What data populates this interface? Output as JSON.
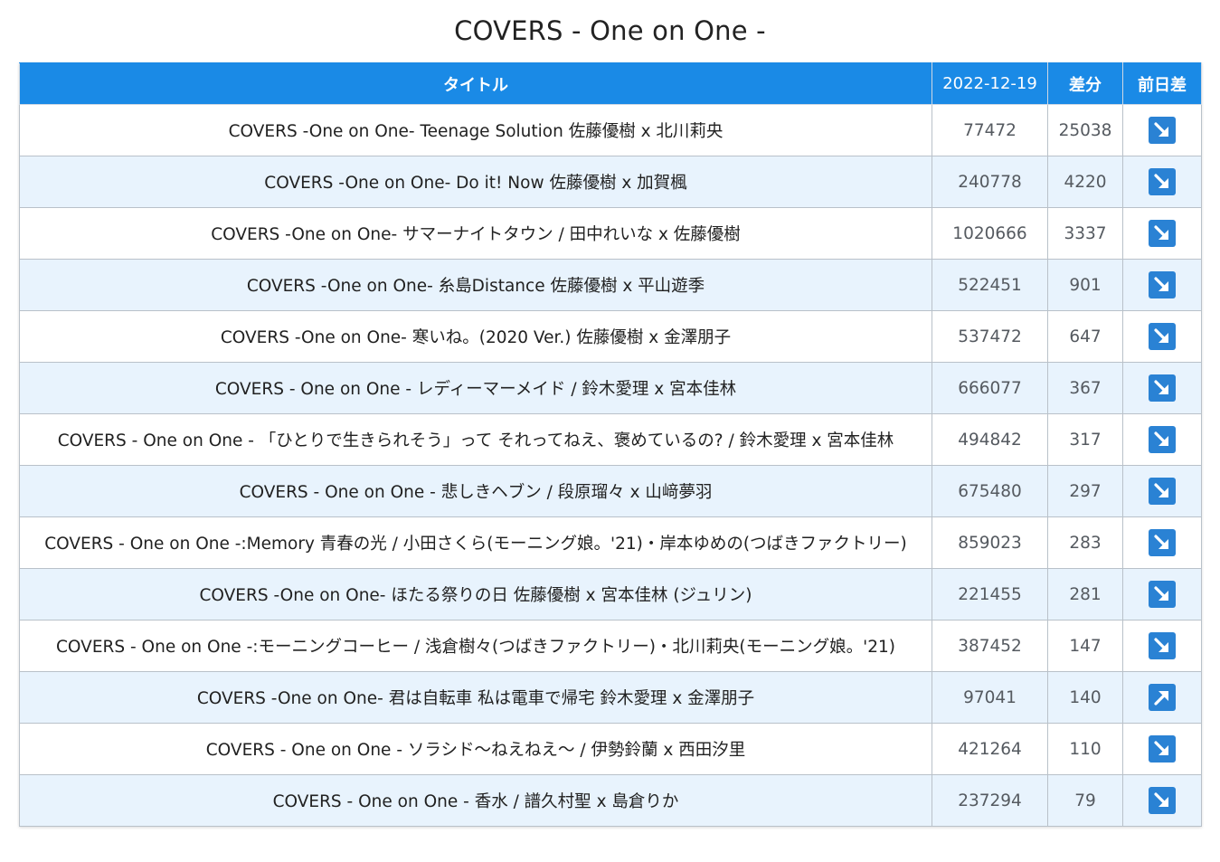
{
  "page": {
    "title": "COVERS - One on One -"
  },
  "table": {
    "headers": {
      "title": "タイトル",
      "count": "2022-12-19",
      "diff": "差分",
      "trend": "前日差"
    },
    "rows": [
      {
        "title": "COVERS -One on One- Teenage Solution 佐藤優樹 x 北川莉央",
        "count": "77472",
        "diff": "25038",
        "trend": "down"
      },
      {
        "title": "COVERS -One on One- Do it! Now 佐藤優樹 x 加賀楓",
        "count": "240778",
        "diff": "4220",
        "trend": "down"
      },
      {
        "title": "COVERS -One on One- サマーナイトタウン / 田中れいな x 佐藤優樹",
        "count": "1020666",
        "diff": "3337",
        "trend": "down"
      },
      {
        "title": "COVERS -One on One- 糸島Distance 佐藤優樹 x 平山遊季",
        "count": "522451",
        "diff": "901",
        "trend": "down"
      },
      {
        "title": "COVERS -One on One- 寒いね。(2020 Ver.) 佐藤優樹 x 金澤朋子",
        "count": "537472",
        "diff": "647",
        "trend": "down"
      },
      {
        "title": "COVERS - One on One - レディーマーメイド / 鈴木愛理 x 宮本佳林",
        "count": "666077",
        "diff": "367",
        "trend": "down"
      },
      {
        "title": "COVERS - One on One - 「ひとりで生きられそう」って それってねえ、褒めているの? / 鈴木愛理 x 宮本佳林",
        "count": "494842",
        "diff": "317",
        "trend": "down"
      },
      {
        "title": "COVERS - One on One - 悲しきヘブン / 段原瑠々 x 山﨑夢羽",
        "count": "675480",
        "diff": "297",
        "trend": "down"
      },
      {
        "title": "COVERS - One on One -:Memory 青春の光 / 小田さくら(モーニング娘。'21)・岸本ゆめの(つばきファクトリー)",
        "count": "859023",
        "diff": "283",
        "trend": "down"
      },
      {
        "title": "COVERS -One on One- ほたる祭りの日 佐藤優樹 x 宮本佳林 (ジュリン)",
        "count": "221455",
        "diff": "281",
        "trend": "down"
      },
      {
        "title": "COVERS - One on One -:モーニングコーヒー / 浅倉樹々(つばきファクトリー)・北川莉央(モーニング娘。'21)",
        "count": "387452",
        "diff": "147",
        "trend": "down"
      },
      {
        "title": "COVERS -One on One- 君は自転車 私は電車で帰宅 鈴木愛理 x 金澤朋子",
        "count": "97041",
        "diff": "140",
        "trend": "up"
      },
      {
        "title": "COVERS - One on One - ソラシド〜ねえねえ〜 / 伊勢鈴蘭 x 西田汐里",
        "count": "421264",
        "diff": "110",
        "trend": "down"
      },
      {
        "title": "COVERS - One on One - 香水 / 譜久村聖 x 島倉りか",
        "count": "237294",
        "diff": "79",
        "trend": "down"
      }
    ]
  },
  "icons": {
    "down": "arrow-down-right-icon",
    "up": "arrow-up-right-icon"
  },
  "colors": {
    "header_bg": "#1a8ae6",
    "row_alt_bg": "#e8f3fd",
    "icon_bg": "#2a82d4"
  }
}
